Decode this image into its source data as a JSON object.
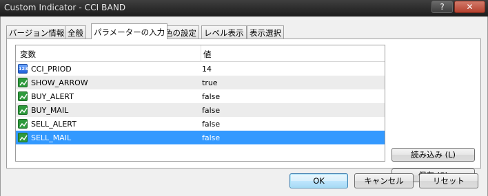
{
  "window": {
    "title": "Custom Indicator - CCI BAND",
    "help_label": "?",
    "close_label": "✕"
  },
  "tabs": [
    {
      "label": "バージョン情報"
    },
    {
      "label": "全般"
    },
    {
      "label": "パラメーターの入力",
      "active": true
    },
    {
      "label": "色の設定"
    },
    {
      "label": "レベル表示"
    },
    {
      "label": "表示選択"
    }
  ],
  "table": {
    "columns": [
      "変数",
      "値"
    ],
    "rows": [
      {
        "name": "CCI_PRIOD",
        "value": "14",
        "icon": "number-icon"
      },
      {
        "name": "SHOW_ARROW",
        "value": "true",
        "icon": "boolean-icon"
      },
      {
        "name": "BUY_ALERT",
        "value": "false",
        "icon": "boolean-icon"
      },
      {
        "name": "BUY_MAIL",
        "value": "false",
        "icon": "boolean-icon"
      },
      {
        "name": "SELL_ALERT",
        "value": "false",
        "icon": "boolean-icon"
      },
      {
        "name": "SELL_MAIL",
        "value": "false",
        "icon": "boolean-icon",
        "selected": true
      }
    ],
    "number_icon_text": "123"
  },
  "buttons": {
    "load": "読み込み (L)",
    "save": "保存 (S)",
    "ok": "OK",
    "cancel": "キャンセル",
    "reset": "リセット"
  },
  "colors": {
    "selection": "#3399ff",
    "alt_row": "#ececec",
    "titlebar": "#2b2b2b"
  }
}
